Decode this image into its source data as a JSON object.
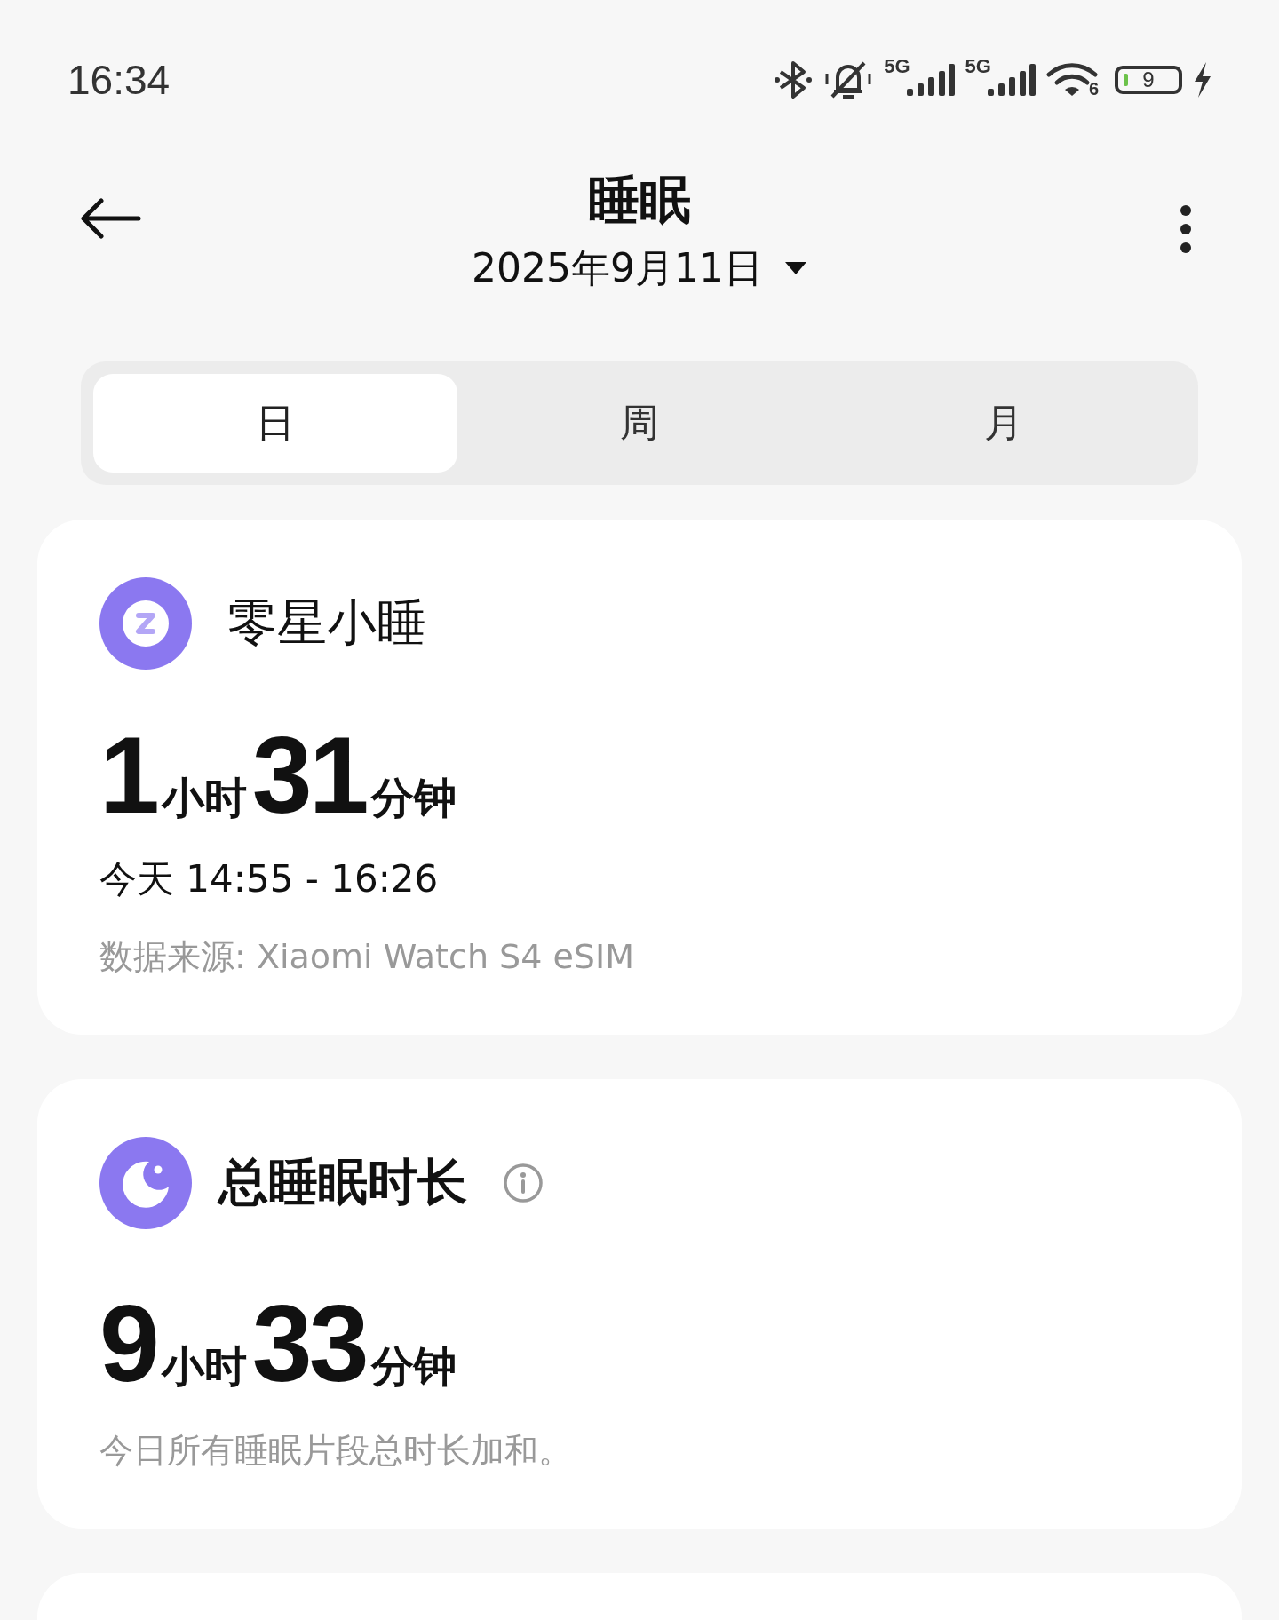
{
  "status_bar": {
    "time": "16:34",
    "network_1": "5G",
    "network_2": "5G",
    "wifi_version": "6",
    "battery": "9",
    "charging": true
  },
  "header": {
    "title": "睡眠",
    "date": "2025年9月11日"
  },
  "tabs": [
    {
      "label": "日",
      "selected": true
    },
    {
      "label": "周",
      "selected": false
    },
    {
      "label": "月",
      "selected": false
    }
  ],
  "cards": [
    {
      "kind": "nap",
      "title": "零星小睡",
      "info": false,
      "hours": "1",
      "hours_unit": "小时",
      "minutes": "31",
      "minutes_unit": "分钟",
      "time_range": "今天 14:55 - 16:26",
      "note": "数据来源: Xiaomi Watch S4 eSIM"
    },
    {
      "kind": "total",
      "title": "总睡眠时长",
      "info": true,
      "hours": "9",
      "hours_unit": "小时",
      "minutes": "33",
      "minutes_unit": "分钟",
      "note": "今日所有睡眠片段总时长加和。"
    }
  ]
}
